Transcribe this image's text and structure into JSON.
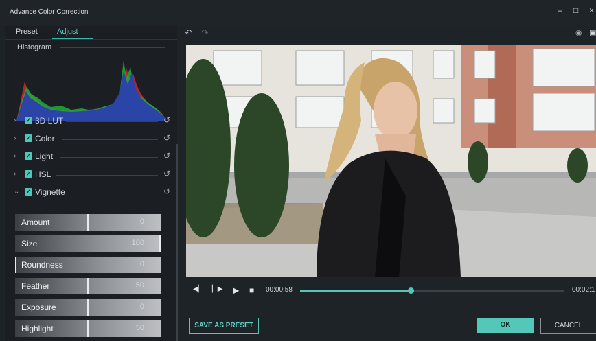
{
  "window": {
    "title": "Advance Color Correction",
    "minimize": "–",
    "maximize": "□",
    "close": "×"
  },
  "tabs": [
    {
      "label": "Preset"
    },
    {
      "label": "Adjust"
    }
  ],
  "histogram": {
    "label": "Histogram"
  },
  "sections": [
    {
      "label": "3D LUT",
      "chevron": "›",
      "reset": "↺",
      "check": "✓"
    },
    {
      "label": "Color",
      "chevron": "›",
      "reset": "↺",
      "check": "✓"
    },
    {
      "label": "Light",
      "chevron": "›",
      "reset": "↺",
      "check": "✓"
    },
    {
      "label": "HSL",
      "chevron": "›",
      "reset": "↺",
      "check": "✓"
    },
    {
      "label": "Vignette",
      "chevron": "⌄",
      "reset": "↺",
      "check": "✓"
    }
  ],
  "vignette_sliders": [
    {
      "label": "Amount",
      "value": "0",
      "level": 0.5
    },
    {
      "label": "Size",
      "value": "100",
      "level": 1.0
    },
    {
      "label": "Roundness",
      "value": "0",
      "level": 0.0
    },
    {
      "label": "Feather",
      "value": "50",
      "level": 0.5
    },
    {
      "label": "Exposure",
      "value": "0",
      "level": 0.5
    },
    {
      "label": "Highlight",
      "value": "50",
      "level": 0.5
    }
  ],
  "toolbar": {
    "undo_icon": "↶",
    "redo_icon": "↷",
    "eye_icon": "◉",
    "compare_icon": "▣"
  },
  "playback": {
    "prev_frame": "◀▏",
    "next_frame": "▏▶",
    "play": "▶",
    "stop": "■",
    "current_time": "00:00:58",
    "total_time": "00:02:1",
    "progress": 0.42
  },
  "buttons": {
    "save_preset": "SAVE AS PRESET",
    "ok": "OK",
    "cancel": "CANCEL"
  },
  "colors": {
    "accent": "#55c7b8",
    "panel": "#1b1f24",
    "background": "#1e2328"
  }
}
